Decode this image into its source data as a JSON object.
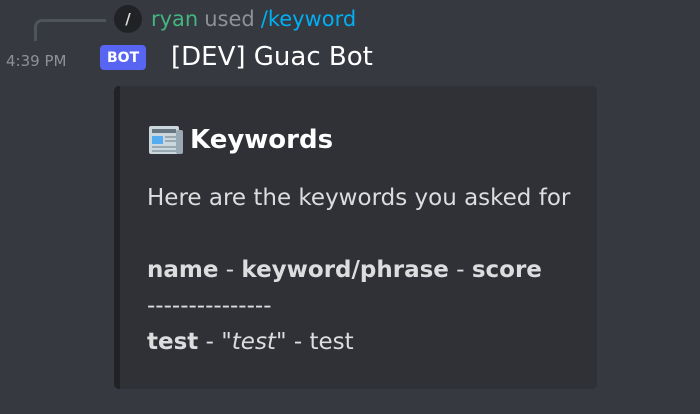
{
  "reply": {
    "icon": "slash-command-icon",
    "icon_glyph": "/",
    "user": "ryan",
    "used": "used",
    "command": "/keyword"
  },
  "message": {
    "timestamp": "4:39 PM",
    "bot_tag": "BOT",
    "author": "[DEV] Guac Bot"
  },
  "embed": {
    "icon": "newspaper-icon",
    "title": "Keywords",
    "description": "Here are the keywords you asked for",
    "header": {
      "col1": "name",
      "sep1": " - ",
      "col2": "keyword/phrase",
      "sep2": " - ",
      "col3": "score"
    },
    "divider": "---------------",
    "row": {
      "name": "test",
      "sep1": " - ",
      "keyword": "\"test\"",
      "sep2": " - ",
      "score": "test"
    }
  },
  "colors": {
    "background": "#36393f",
    "embed_background": "#2f3136",
    "username": "#43b581",
    "command": "#00aff4",
    "bot_tag": "#5865f2"
  }
}
